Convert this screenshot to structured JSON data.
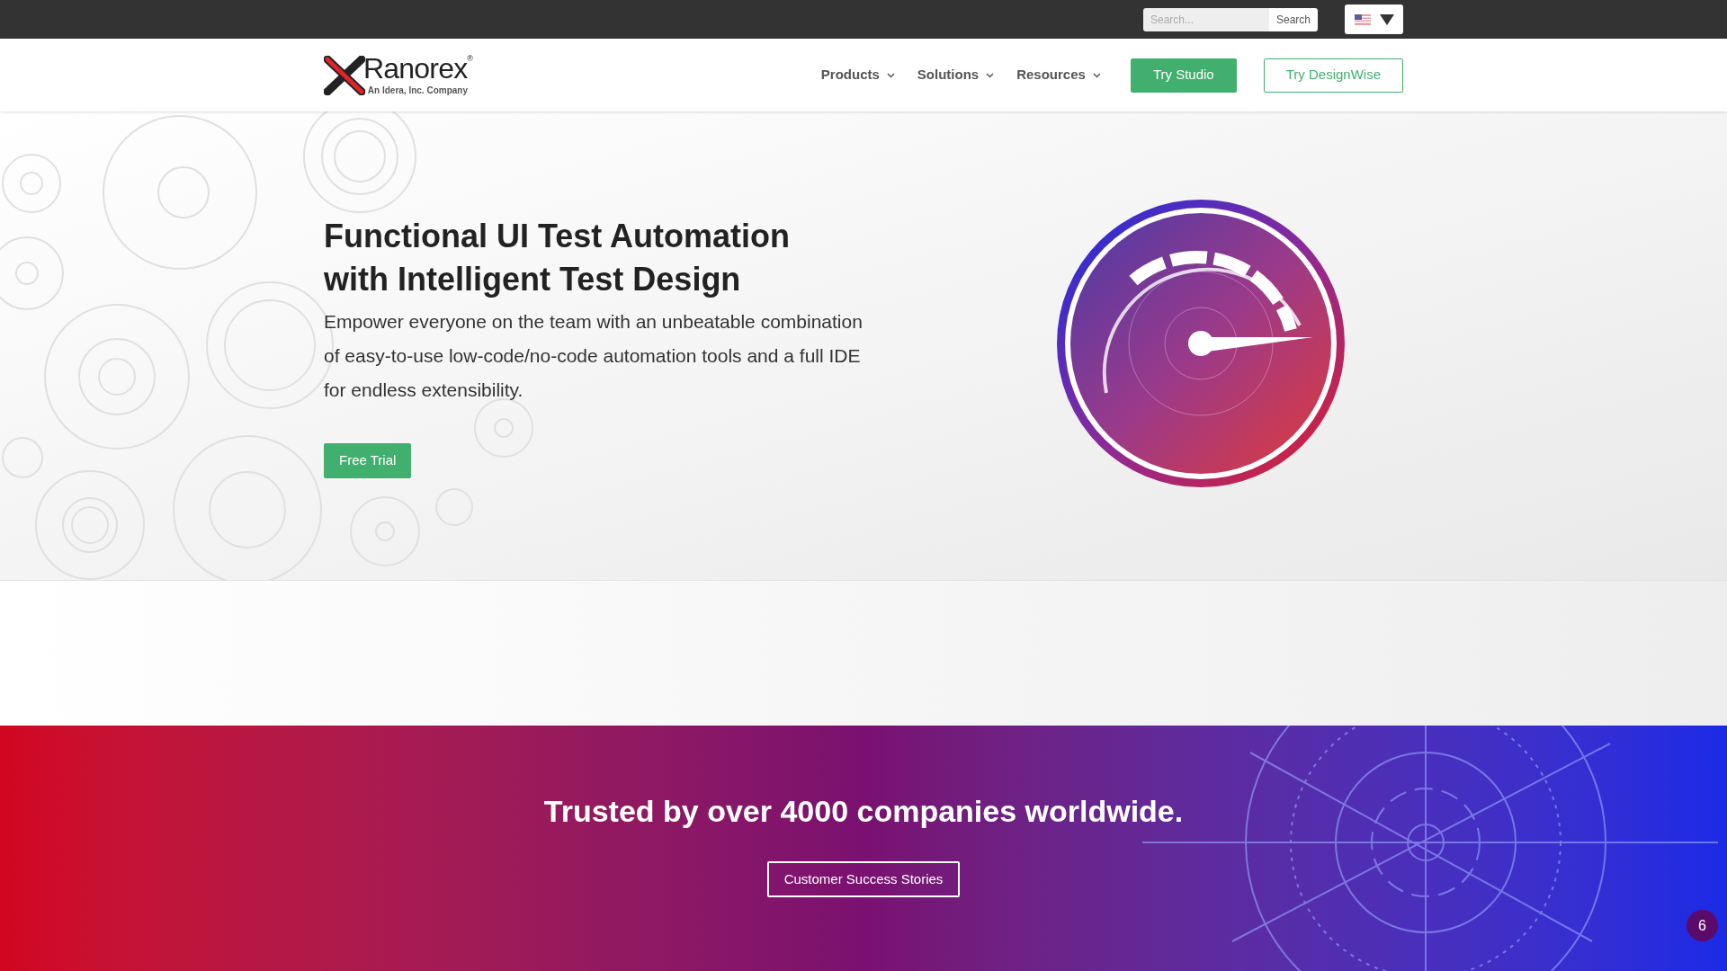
{
  "top_bar": {
    "search": {
      "placeholder": "Search...",
      "button": "Search"
    }
  },
  "header": {
    "logo": {
      "name": "Ranorex",
      "registered": "®",
      "tagline": "An Idera, Inc. Company"
    },
    "nav": [
      {
        "label": "Products"
      },
      {
        "label": "Solutions"
      },
      {
        "label": "Resources"
      }
    ],
    "buttons": [
      {
        "label": "Try Studio",
        "kind": "solid"
      },
      {
        "label": "Try DesignWise",
        "kind": "outline"
      }
    ]
  },
  "hero": {
    "title_lines": [
      "Functional UI Test Automation",
      "with Intelligent Test Design"
    ],
    "text": "Empower everyone on the team with an unbeatable combination of easy-to-use low-code/no-code automation tools and a full IDE for endless extensibility.",
    "button": "Free Trial"
  },
  "trust": {
    "heading": "Trusted by over 4000 companies worldwide.",
    "button": "Customer Success Stories"
  },
  "notification_badge": "6"
}
